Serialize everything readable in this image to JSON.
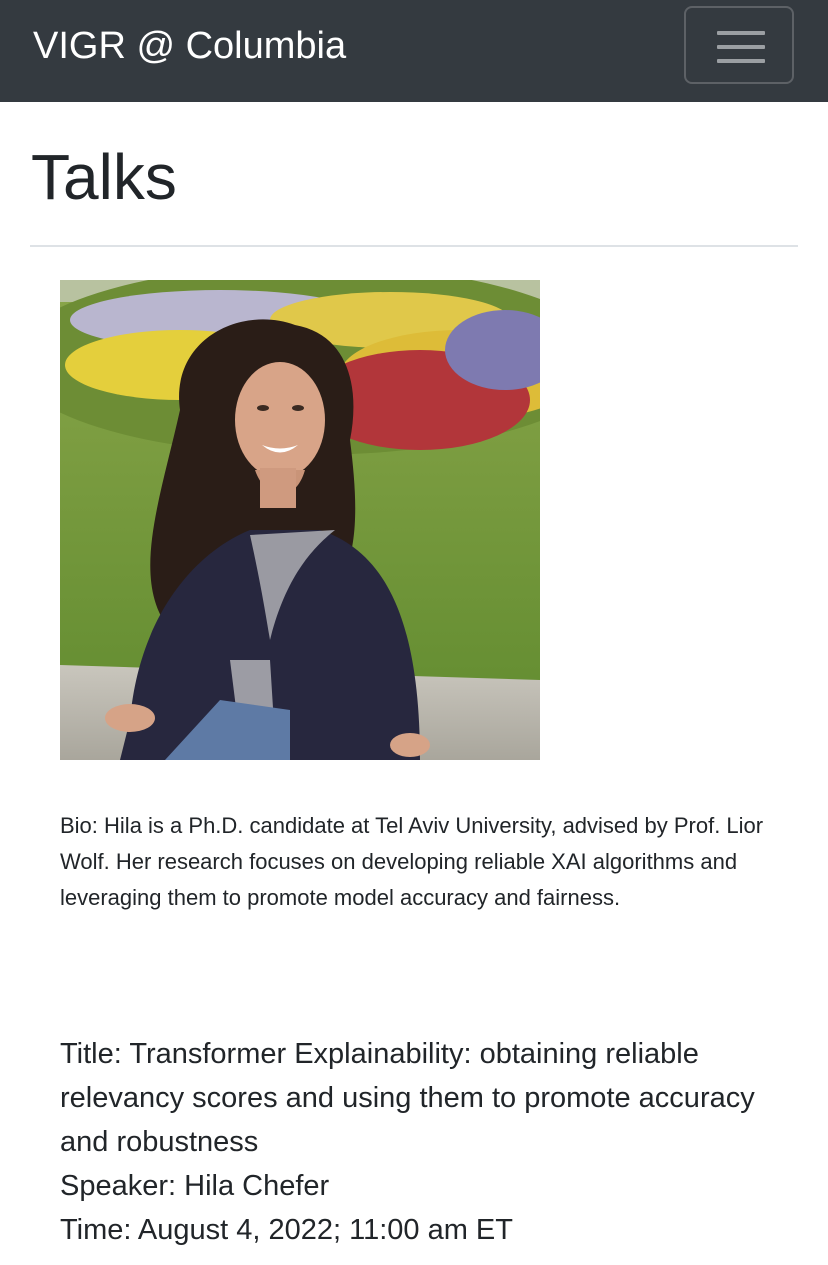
{
  "navbar": {
    "brand": "VIGR @ Columbia",
    "toggler_icon": "hamburger-menu-icon"
  },
  "page": {
    "title": "Talks"
  },
  "speaker_photo": {
    "description_icon": "speaker-portrait"
  },
  "bio": {
    "label": "Bio:",
    "text": " Hila is a Ph.D. candidate at Tel Aviv University, advised by Prof. Lior Wolf. Her research focuses on developing reliable XAI algorithms and leveraging them to promote model accuracy and fairness."
  },
  "talk": {
    "title_label": "Title:",
    "title_value": " Transformer Explainability: obtaining reliable relevancy scores and using them to promote accuracy and robustness",
    "speaker_label": "Speaker:",
    "speaker_value": " Hila Chefer",
    "time_label": "Time:",
    "time_value": " August 4, 2022; 11:00 am ET"
  },
  "colors": {
    "navbar_bg": "#343a40",
    "brand_text": "#ffffff",
    "body_text": "#212529",
    "divider": "#dee2e6"
  }
}
